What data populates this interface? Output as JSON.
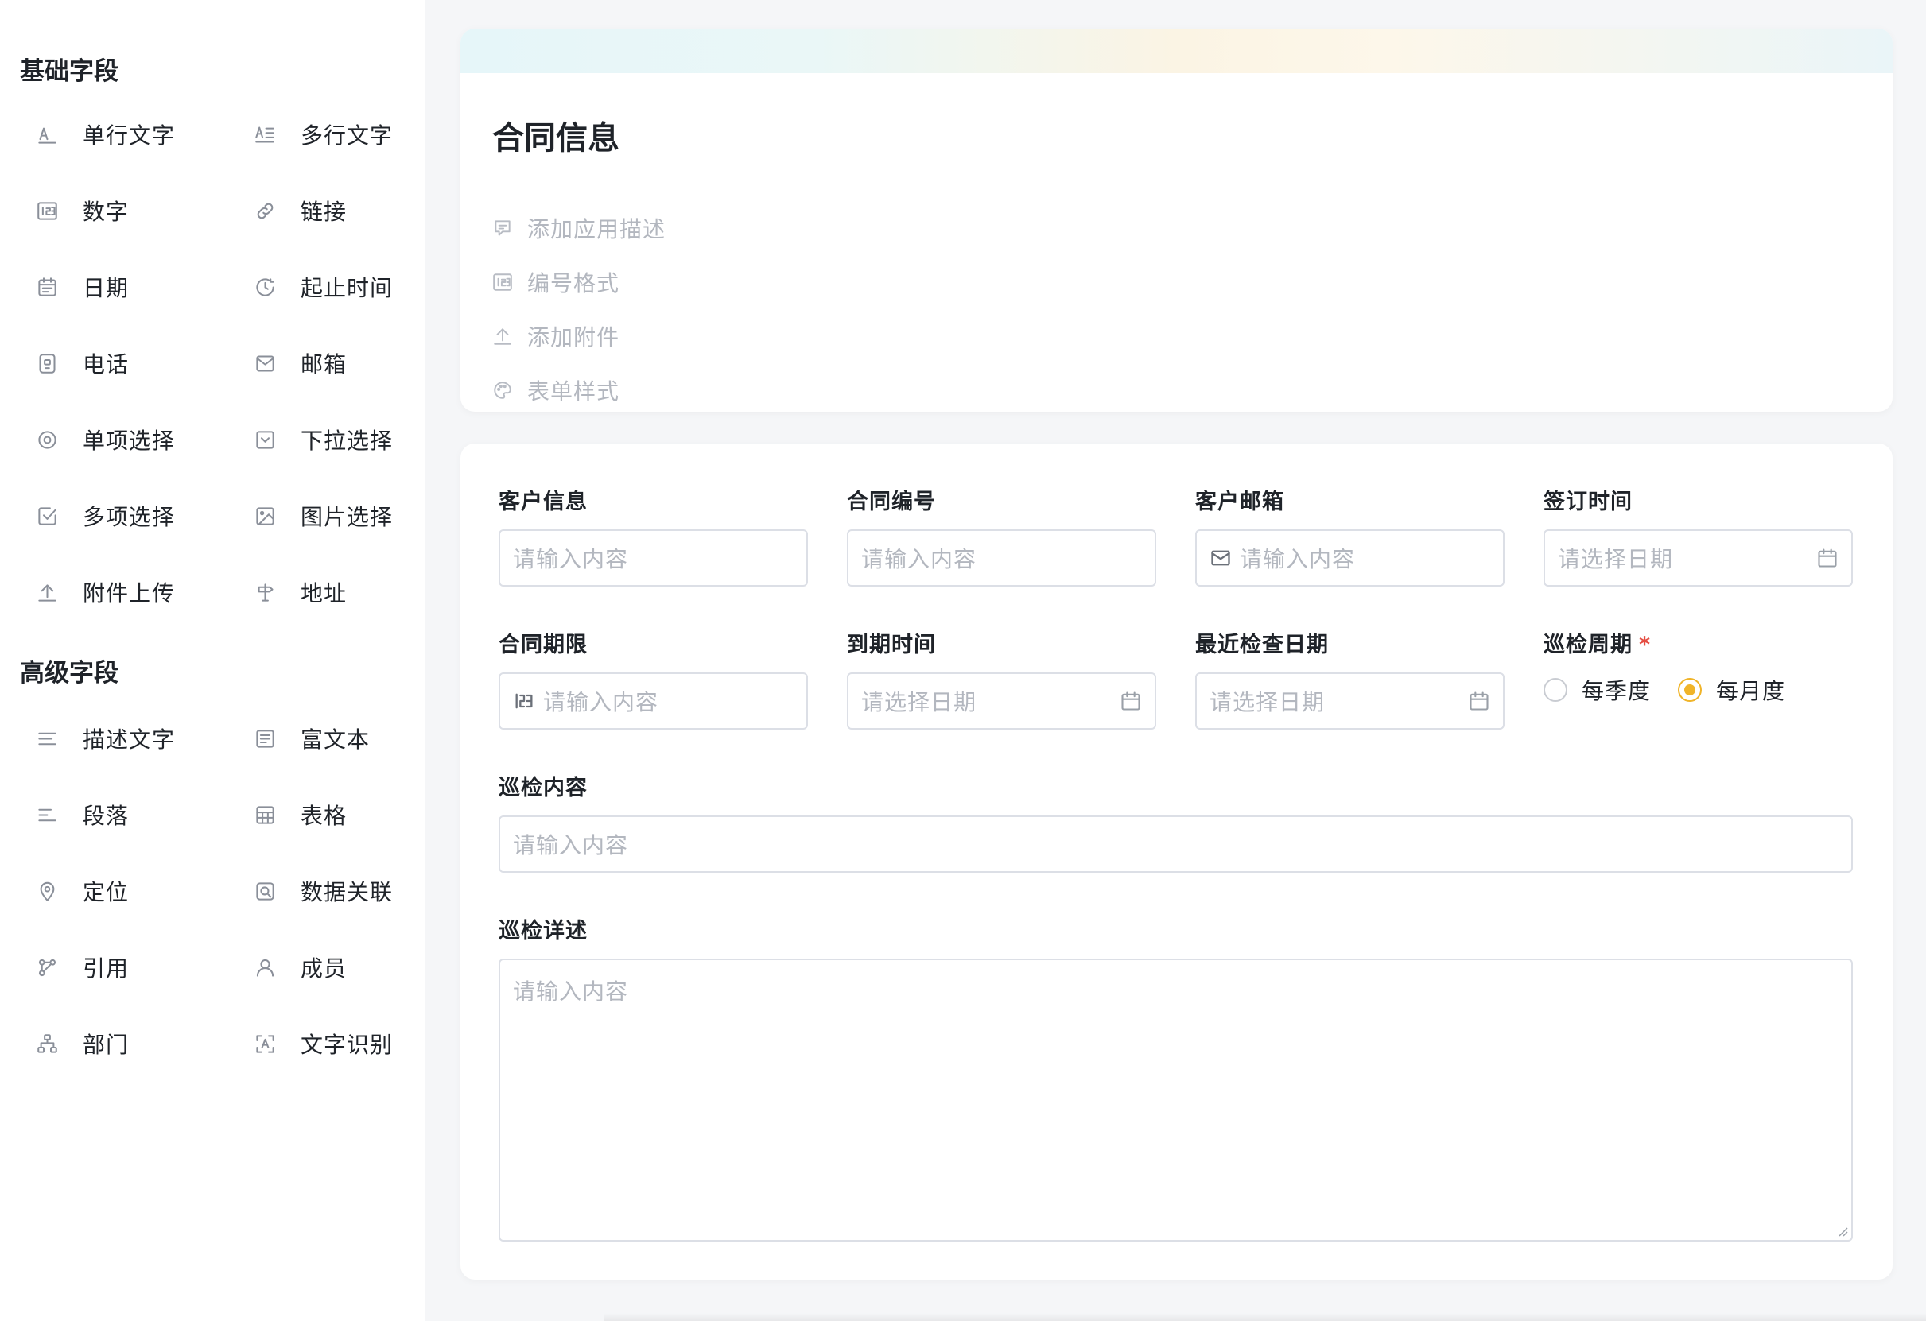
{
  "sidebar": {
    "basic_title": "基础字段",
    "advanced_title": "高级字段",
    "basic_items": [
      {
        "label": "单行文字",
        "icon": "single-line-text-icon"
      },
      {
        "label": "多行文字",
        "icon": "multi-line-text-icon"
      },
      {
        "label": "数字",
        "icon": "number-icon"
      },
      {
        "label": "链接",
        "icon": "link-icon"
      },
      {
        "label": "日期",
        "icon": "calendar-icon"
      },
      {
        "label": "起止时间",
        "icon": "time-range-icon"
      },
      {
        "label": "电话",
        "icon": "phone-icon"
      },
      {
        "label": "邮箱",
        "icon": "mail-icon"
      },
      {
        "label": "单项选择",
        "icon": "radio-icon"
      },
      {
        "label": "下拉选择",
        "icon": "dropdown-icon"
      },
      {
        "label": "多项选择",
        "icon": "checkbox-icon"
      },
      {
        "label": "图片选择",
        "icon": "image-icon"
      },
      {
        "label": "附件上传",
        "icon": "upload-icon"
      },
      {
        "label": "地址",
        "icon": "signpost-icon"
      }
    ],
    "advanced_items": [
      {
        "label": "描述文字",
        "icon": "description-icon"
      },
      {
        "label": "富文本",
        "icon": "rich-text-icon"
      },
      {
        "label": "段落",
        "icon": "paragraph-icon"
      },
      {
        "label": "表格",
        "icon": "table-icon"
      },
      {
        "label": "定位",
        "icon": "location-pin-icon"
      },
      {
        "label": "数据关联",
        "icon": "data-link-icon"
      },
      {
        "label": "引用",
        "icon": "reference-icon"
      },
      {
        "label": "成员",
        "icon": "member-icon"
      },
      {
        "label": "部门",
        "icon": "department-icon"
      },
      {
        "label": "文字识别",
        "icon": "text-recognition-icon"
      }
    ]
  },
  "info": {
    "title": "合同信息",
    "actions": [
      {
        "label": "添加应用描述",
        "icon": "comment-icon"
      },
      {
        "label": "编号格式",
        "icon": "number-format-icon"
      },
      {
        "label": "添加附件",
        "icon": "upload-icon"
      },
      {
        "label": "表单样式",
        "icon": "palette-icon"
      }
    ]
  },
  "form": {
    "fields": {
      "customer_info": {
        "label": "客户信息",
        "placeholder": "请输入内容"
      },
      "contract_no": {
        "label": "合同编号",
        "placeholder": "请输入内容"
      },
      "customer_email": {
        "label": "客户邮箱",
        "placeholder": "请输入内容"
      },
      "sign_time": {
        "label": "签订时间",
        "placeholder": "请选择日期"
      },
      "contract_term": {
        "label": "合同期限",
        "placeholder": "请输入内容"
      },
      "expire_time": {
        "label": "到期时间",
        "placeholder": "请选择日期"
      },
      "last_check_date": {
        "label": "最近检查日期",
        "placeholder": "请选择日期"
      },
      "inspection_cycle": {
        "label": "巡检周期",
        "required_mark": "*",
        "options": [
          "每季度",
          "每月度"
        ],
        "selected": "每月度"
      },
      "inspection_content": {
        "label": "巡检内容",
        "placeholder": "请输入内容"
      },
      "inspection_detail": {
        "label": "巡检详述",
        "placeholder": "请输入内容"
      }
    }
  },
  "colors": {
    "accent": "#f0b429",
    "required": "#e54d42",
    "placeholder": "#b3b7bf",
    "border": "#dcdfe6"
  }
}
